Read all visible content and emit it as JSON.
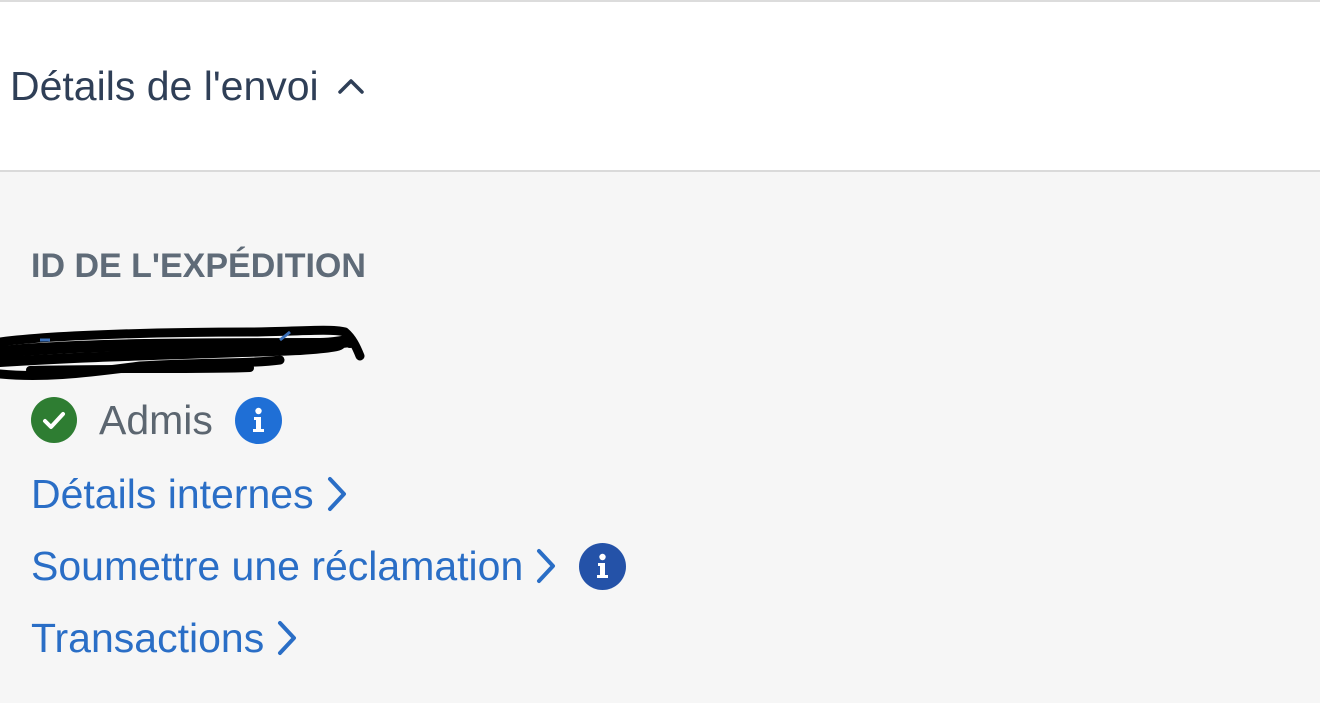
{
  "header": {
    "title": "Détails de l'envoi"
  },
  "shipment": {
    "id_label": "ID DE L'EXPÉDITION",
    "status": "Admis"
  },
  "links": {
    "internal_details": "Détails internes",
    "submit_claim": "Soumettre une réclamation",
    "transactions": "Transactions"
  },
  "colors": {
    "link": "#2a6ec6",
    "status_success": "#2e7d32",
    "info": "#1f6fd6",
    "info_dark": "#2452a8",
    "panel_bg": "#f6f6f6"
  },
  "icons": {
    "header_toggle": "chevron-up-icon",
    "status": "check-circle-icon",
    "info": "info-icon",
    "link_arrow": "chevron-right-icon"
  }
}
